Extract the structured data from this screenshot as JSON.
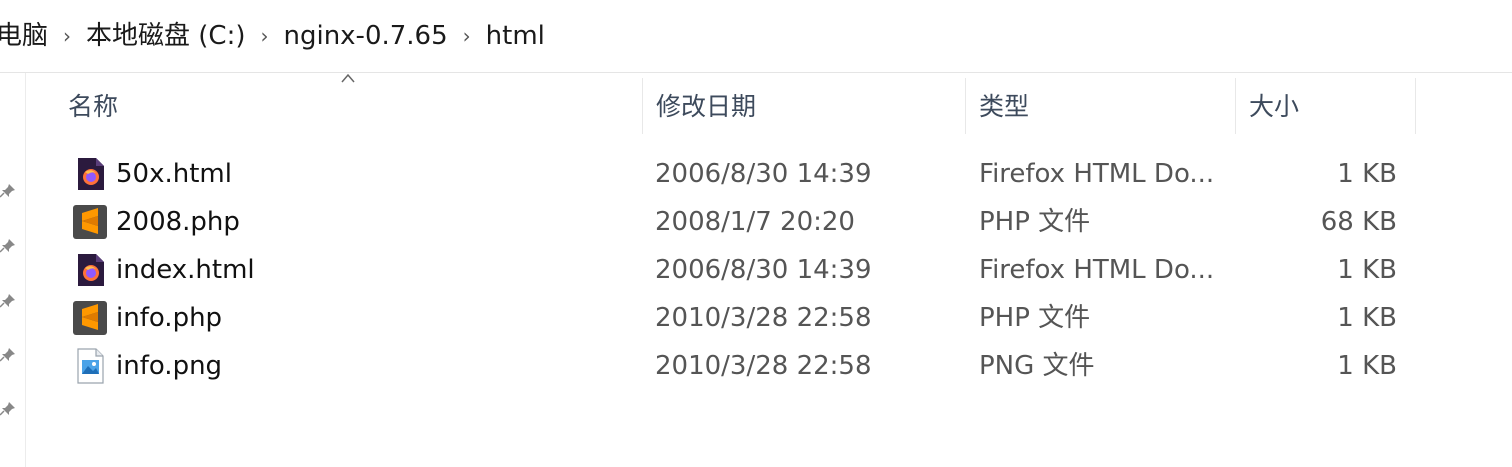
{
  "breadcrumb": {
    "items": [
      "电脑",
      "本地磁盘 (C:)",
      "nginx-0.7.65",
      "html"
    ],
    "separator": "›"
  },
  "columns": {
    "name": "名称",
    "date": "修改日期",
    "type": "类型",
    "size": "大小"
  },
  "files": [
    {
      "name": "50x.html",
      "date": "2006/8/30 14:39",
      "type": "Firefox HTML Do...",
      "size": "1 KB",
      "icon": "firefox-html-icon"
    },
    {
      "name": "2008.php",
      "date": "2008/1/7 20:20",
      "type": "PHP 文件",
      "size": "68 KB",
      "icon": "sublime-php-icon"
    },
    {
      "name": "index.html",
      "date": "2006/8/30 14:39",
      "type": "Firefox HTML Do...",
      "size": "1 KB",
      "icon": "firefox-html-icon"
    },
    {
      "name": "info.php",
      "date": "2010/3/28 22:58",
      "type": "PHP 文件",
      "size": "1 KB",
      "icon": "sublime-php-icon"
    },
    {
      "name": "info.png",
      "date": "2010/3/28 22:58",
      "type": "PNG 文件",
      "size": "1 KB",
      "icon": "png-image-icon"
    }
  ],
  "colors": {
    "firefox_bg": "#2b1a3e",
    "sublime_bg": "#4a4a4a",
    "sublime_accent": "#ff9800",
    "header_text": "#3d4a5c"
  }
}
